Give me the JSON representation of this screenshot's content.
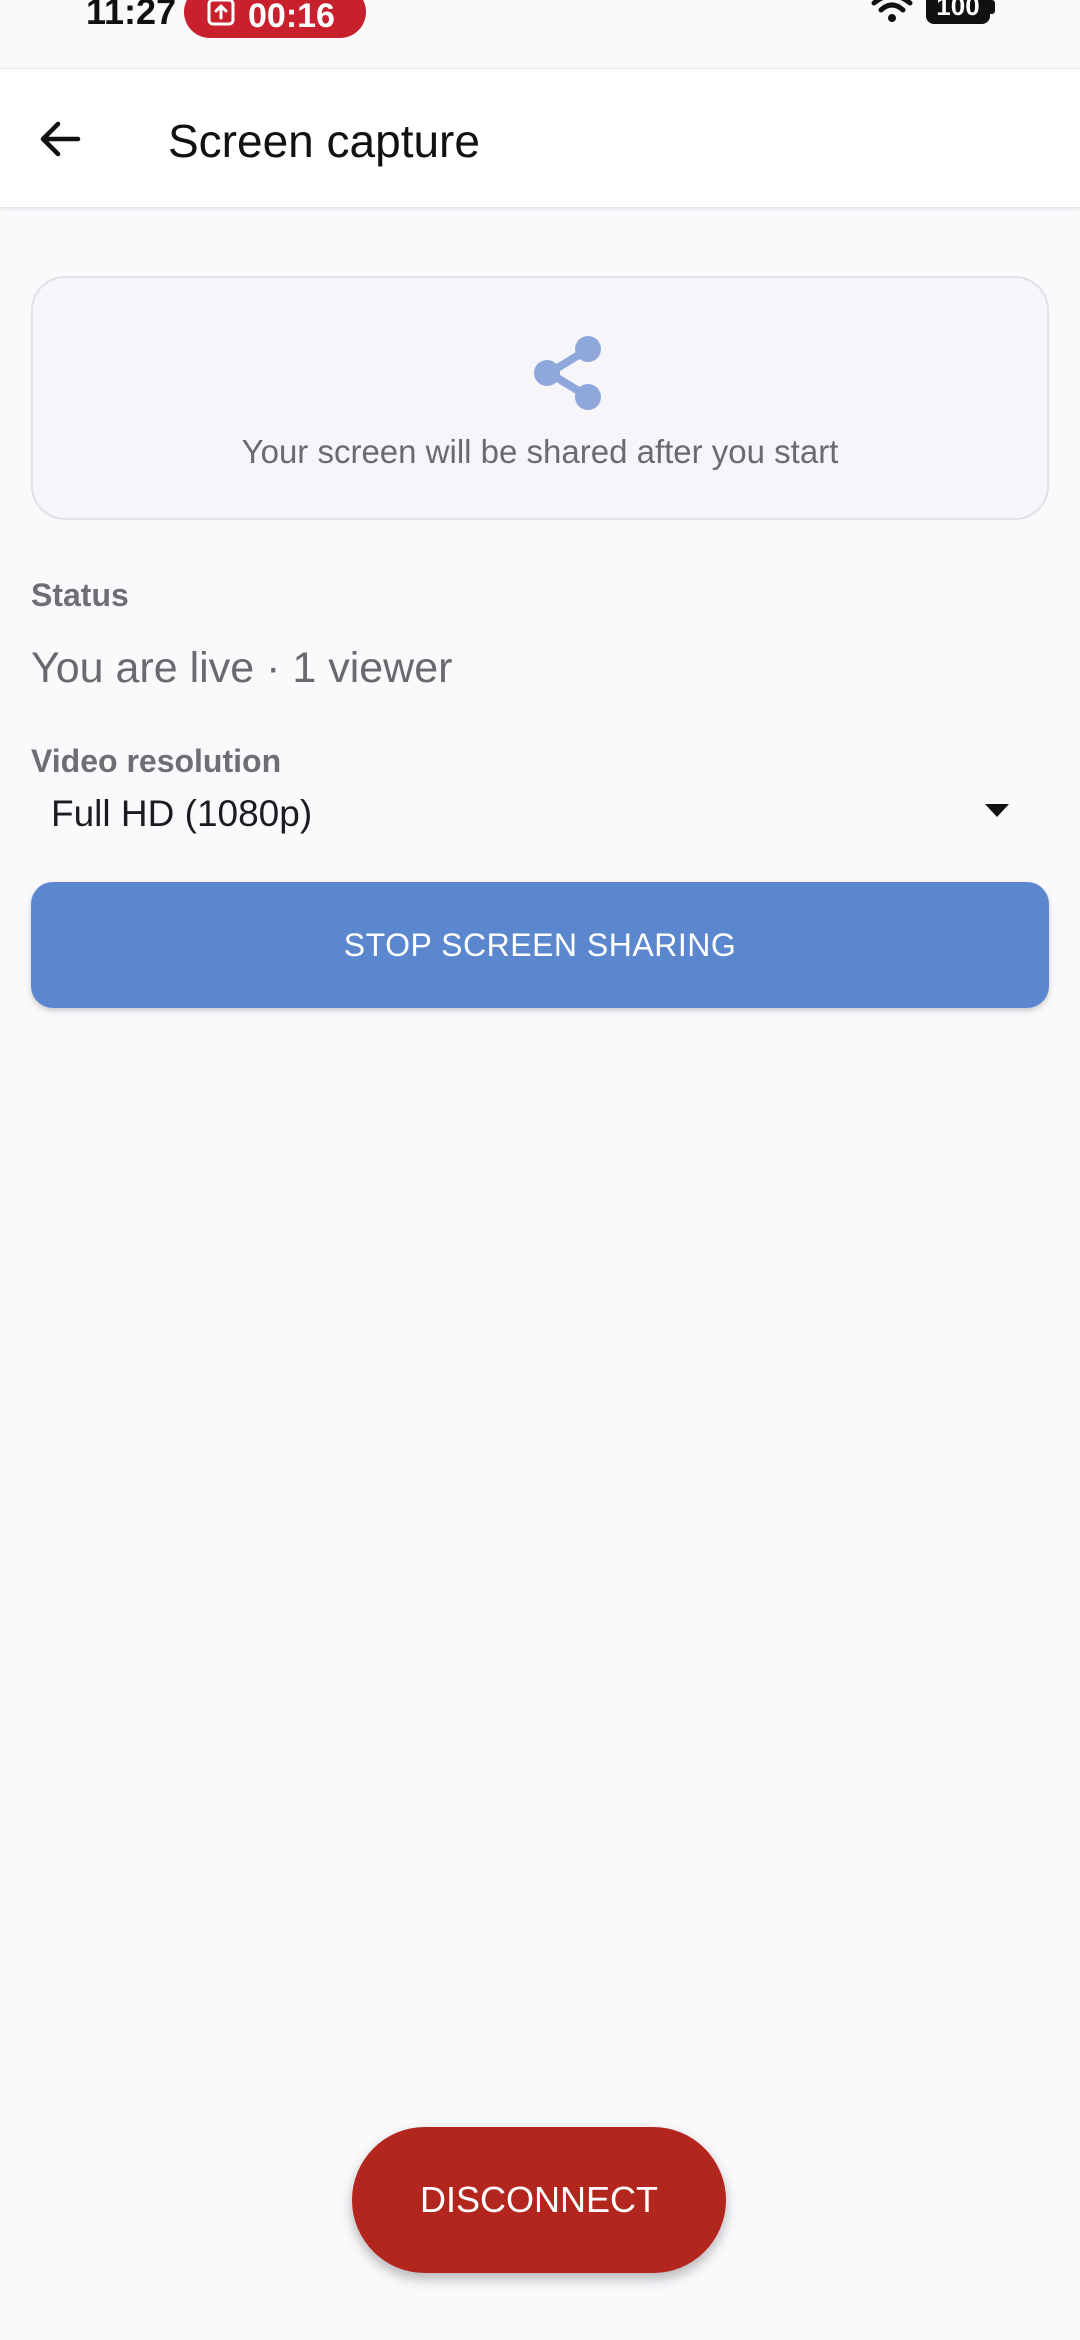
{
  "status_bar": {
    "time": "11:27",
    "recording_time": "00:16",
    "battery": "100"
  },
  "header": {
    "title": "Screen capture"
  },
  "preview": {
    "message": "Your screen will be shared after you start"
  },
  "status": {
    "label": "Status",
    "value": "You are live · 1 viewer"
  },
  "resolution": {
    "label": "Video resolution",
    "selected": "Full HD (1080p)"
  },
  "actions": {
    "stop_label": "STOP SCREEN SHARING",
    "disconnect_label": "DISCONNECT"
  },
  "icons": {
    "back": "arrow-left-icon",
    "share": "share-icon",
    "recording": "screen-record-icon",
    "wifi": "wifi-icon",
    "dropdown": "dropdown-caret-icon"
  },
  "colors": {
    "primary": "#5a87ce",
    "danger": "#b3261e",
    "recording": "#c8202c",
    "share_icon": "#8fa8db"
  }
}
